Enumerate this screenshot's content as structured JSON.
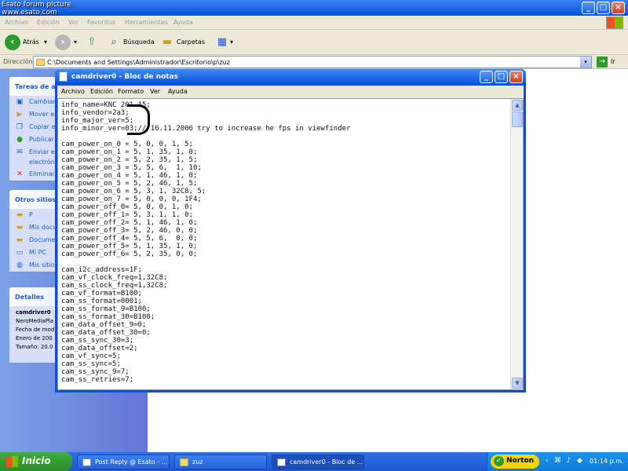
{
  "watermark": {
    "line1": "Esato forum picture",
    "line2": "www.esato.com"
  },
  "explorer": {
    "menu": [
      "Archivo",
      "Edición",
      "Ver",
      "Favoritos",
      "Herramientas",
      "Ayuda"
    ],
    "toolbar": {
      "back": "Atrás",
      "search": "Búsqueda",
      "folders": "Carpetas"
    },
    "address_label": "Dirección",
    "address_value": "C:\\Documents and Settings\\Administrador\\Escritorio\\p\\zuz",
    "go_label": "Ir",
    "tasks_panel": {
      "title": "Tareas de a",
      "items": [
        "Cambiar",
        "Mover es",
        "Copiar e",
        "Publicar",
        "Enviar es",
        "electróni",
        "Eliminar e"
      ]
    },
    "places_panel": {
      "title": "Otros sitios",
      "items": [
        "P",
        "Mis docu",
        "Documen",
        "Mi PC",
        "Mis sitios"
      ]
    },
    "details_panel": {
      "title": "Detalles",
      "name": "camdriver0",
      "type": "NeroMediaPla",
      "date_label": "Fecha de mod",
      "date_value": "Enero de 200",
      "size": "Tamaño: 20.0"
    }
  },
  "notepad": {
    "title": "camdriver0 - Bloc de notas",
    "menu": [
      "Archivo",
      "Edición",
      "Formato",
      "Ver",
      "Ayuda"
    ],
    "lines": [
      "info_name=KNC 201 15;",
      "info_vendor=2a3;",
      "info_major_ver=5;",
      "info_minor_ver=03;// 16.11.2006 try to increase he fps in viewfinder",
      "",
      "cam_power_on_0 = 5, 0, 0, 1, 5;",
      "cam_power_on_1 = 5, 1, 35, 1, 0;",
      "cam_power_on_2 = 5, 2, 35, 1, 5;",
      "cam_power_on_3 = 5, 5, 6,  1, 10;",
      "cam_power_on_4 = 5, 1, 46, 1, 0;",
      "cam_power_on_5 = 5, 2, 46, 1, 5;",
      "cam_power_on_6 = 5, 3, 1, 32C8, 5;",
      "cam_power_on_7 = 5, 0, 0, 0, 1F4;",
      "cam_power_off_0= 5, 0, 0, 1, 0;",
      "cam_power_off_1= 5, 3, 1, 1, 0;",
      "cam_power_off_2= 5, 1, 46, 1, 0;",
      "cam_power_off_3= 5, 2, 46, 0, 0;",
      "cam_power_off_4= 5, 5, 6,  0, 0;",
      "cam_power_off_5= 5, 1, 35, 1, 0;",
      "cam_power_off_6= 5, 2, 35, 0, 0;",
      "",
      "cam_i2c_address=1F;",
      "cam_vf_clock_freq=1,32C8;",
      "cam_ss_clock_freq=1,32C8;",
      "cam_vf_format=B100;",
      "cam_ss_format=0001;",
      "cam_ss_format_9=B100;",
      "cam_ss_format_30=B100;",
      "cam_data_offset_9=0;",
      "cam_data_offset_30=0;",
      "cam_ss_sync_30=3;",
      "cam_data_offset=2;",
      "cam_vf_sync=5;",
      "cam_ss_sync=5;",
      "cam_ss_sync_9=7;",
      "cam_ss_retries=7;"
    ]
  },
  "taskbar": {
    "start": "Inicio",
    "tasks": [
      "Post Reply @ Esato - ...",
      "zuz",
      "camdriver0 - Bloc de ..."
    ],
    "norton": "Norton",
    "clock": "01:14 p.m."
  }
}
